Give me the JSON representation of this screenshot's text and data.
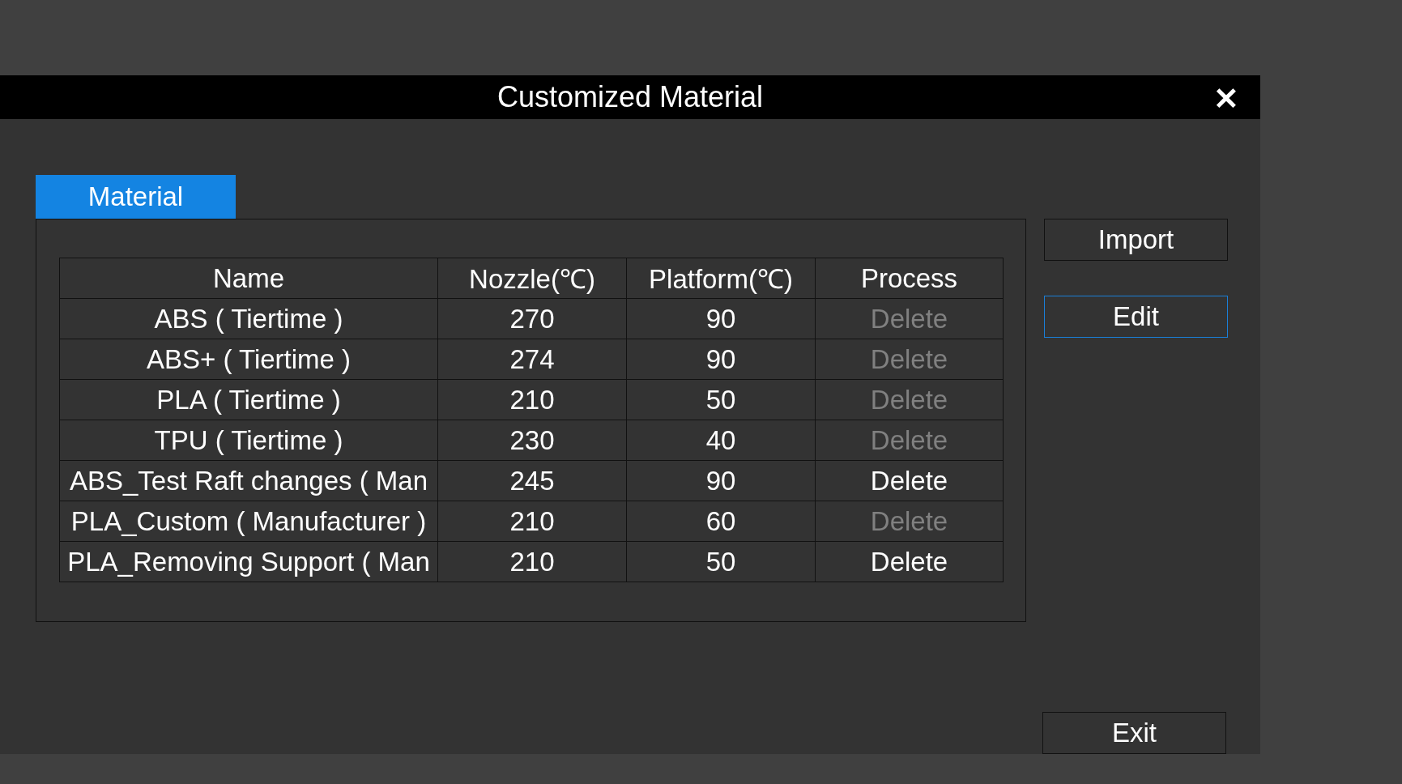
{
  "window": {
    "title": "Customized Material",
    "close": "✕"
  },
  "tabs": [
    {
      "label": "Material",
      "selected": true
    }
  ],
  "table": {
    "columns": [
      "Name",
      "Nozzle(℃)",
      "Platform(℃)",
      "Process"
    ],
    "rows": [
      {
        "name": "ABS ( Tiertime )",
        "nozzle": "270",
        "platform": "90",
        "action": "Delete",
        "disabled": true
      },
      {
        "name": "ABS+ ( Tiertime )",
        "nozzle": "274",
        "platform": "90",
        "action": "Delete",
        "disabled": true
      },
      {
        "name": "PLA ( Tiertime )",
        "nozzle": "210",
        "platform": "50",
        "action": "Delete",
        "disabled": true
      },
      {
        "name": "TPU ( Tiertime )",
        "nozzle": "230",
        "platform": "40",
        "action": "Delete",
        "disabled": true
      },
      {
        "name": "ABS_Test Raft changes ( Man",
        "nozzle": "245",
        "platform": "90",
        "action": "Delete",
        "disabled": false
      },
      {
        "name": "PLA_Custom ( Manufacturer )",
        "nozzle": "210",
        "platform": "60",
        "action": "Delete",
        "disabled": true
      },
      {
        "name": "PLA_Removing Support ( Man",
        "nozzle": "210",
        "platform": "50",
        "action": "Delete",
        "disabled": false
      }
    ]
  },
  "side_buttons": [
    {
      "label": "Import",
      "focused": false
    },
    {
      "label": "Edit",
      "focused": true
    }
  ],
  "exit_button": {
    "label": "Exit"
  }
}
